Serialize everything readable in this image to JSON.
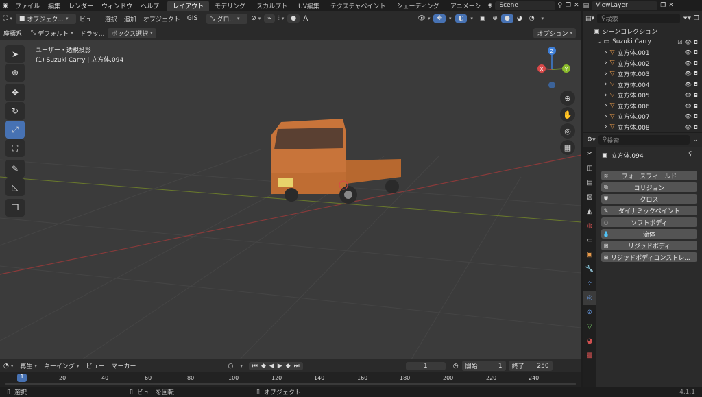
{
  "topbar": {
    "menus": [
      "ファイル",
      "編集",
      "レンダー",
      "ウィンドウ",
      "ヘルプ"
    ],
    "workspaces": [
      "レイアウト",
      "モデリング",
      "スカルプト",
      "UV編集",
      "テクスチャペイント",
      "シェーディング",
      "アニメーシ"
    ],
    "active_workspace": "レイアウト",
    "scene": "Scene",
    "view_layer": "ViewLayer"
  },
  "viewport_header": {
    "mode": "オブジェク...",
    "menus": [
      "ビュー",
      "選択",
      "追加",
      "オブジェクト",
      "GIS"
    ],
    "transform_orientation": "グロ...",
    "coord_label": "座標系:",
    "coord_value": "デフォルト",
    "drag_label": "ドラッ...",
    "box_select": "ボックス選択",
    "options": "オプション"
  },
  "viewport": {
    "view_name": "ユーザー・透視投影",
    "object_info": "(1) Suzuki Carry | 立方体.094",
    "gizmo": {
      "x": "X",
      "y": "Y",
      "z": "Z"
    },
    "tools": [
      "select-tool",
      "cursor-tool",
      "move-tool",
      "rotate-tool",
      "scale-tool",
      "transform-tool",
      "annotate-tool",
      "measure-tool",
      "add-cube-tool"
    ],
    "active_tool_index": 4
  },
  "timeline": {
    "menus": [
      "再生",
      "キーイング",
      "ビュー",
      "マーカー"
    ],
    "current_frame": "1",
    "start_label": "開始",
    "start": "1",
    "end_label": "終了",
    "end": "250",
    "ticks": [
      "1",
      "20",
      "40",
      "60",
      "80",
      "100",
      "120",
      "140",
      "160",
      "180",
      "200",
      "220",
      "240"
    ]
  },
  "statusbar": {
    "select": "選択",
    "rotate": "ビューを回転",
    "object": "オブジェクト",
    "version": "4.1.1"
  },
  "outliner": {
    "search_placeholder": "検索",
    "scene_collection": "シーンコレクション",
    "collection": "Suzuki Carry",
    "items": [
      "立方体.001",
      "立方体.002",
      "立方体.003",
      "立方体.004",
      "立方体.005",
      "立方体.006",
      "立方体.007",
      "立方体.008"
    ]
  },
  "properties": {
    "search_placeholder": "検索",
    "object_name": "立方体.094",
    "physics_buttons": [
      "フォースフィールド",
      "コリジョン",
      "クロス",
      "ダイナミックペイント",
      "ソフトボディ",
      "流体",
      "リジッドボディ",
      "リジッドボディコンストレ..."
    ]
  },
  "colors": {
    "accent": "#4772b3",
    "x_axis": "#d94848",
    "y_axis": "#8bbb2c",
    "z_axis": "#3e7fd9",
    "truck": "#c8743a"
  }
}
